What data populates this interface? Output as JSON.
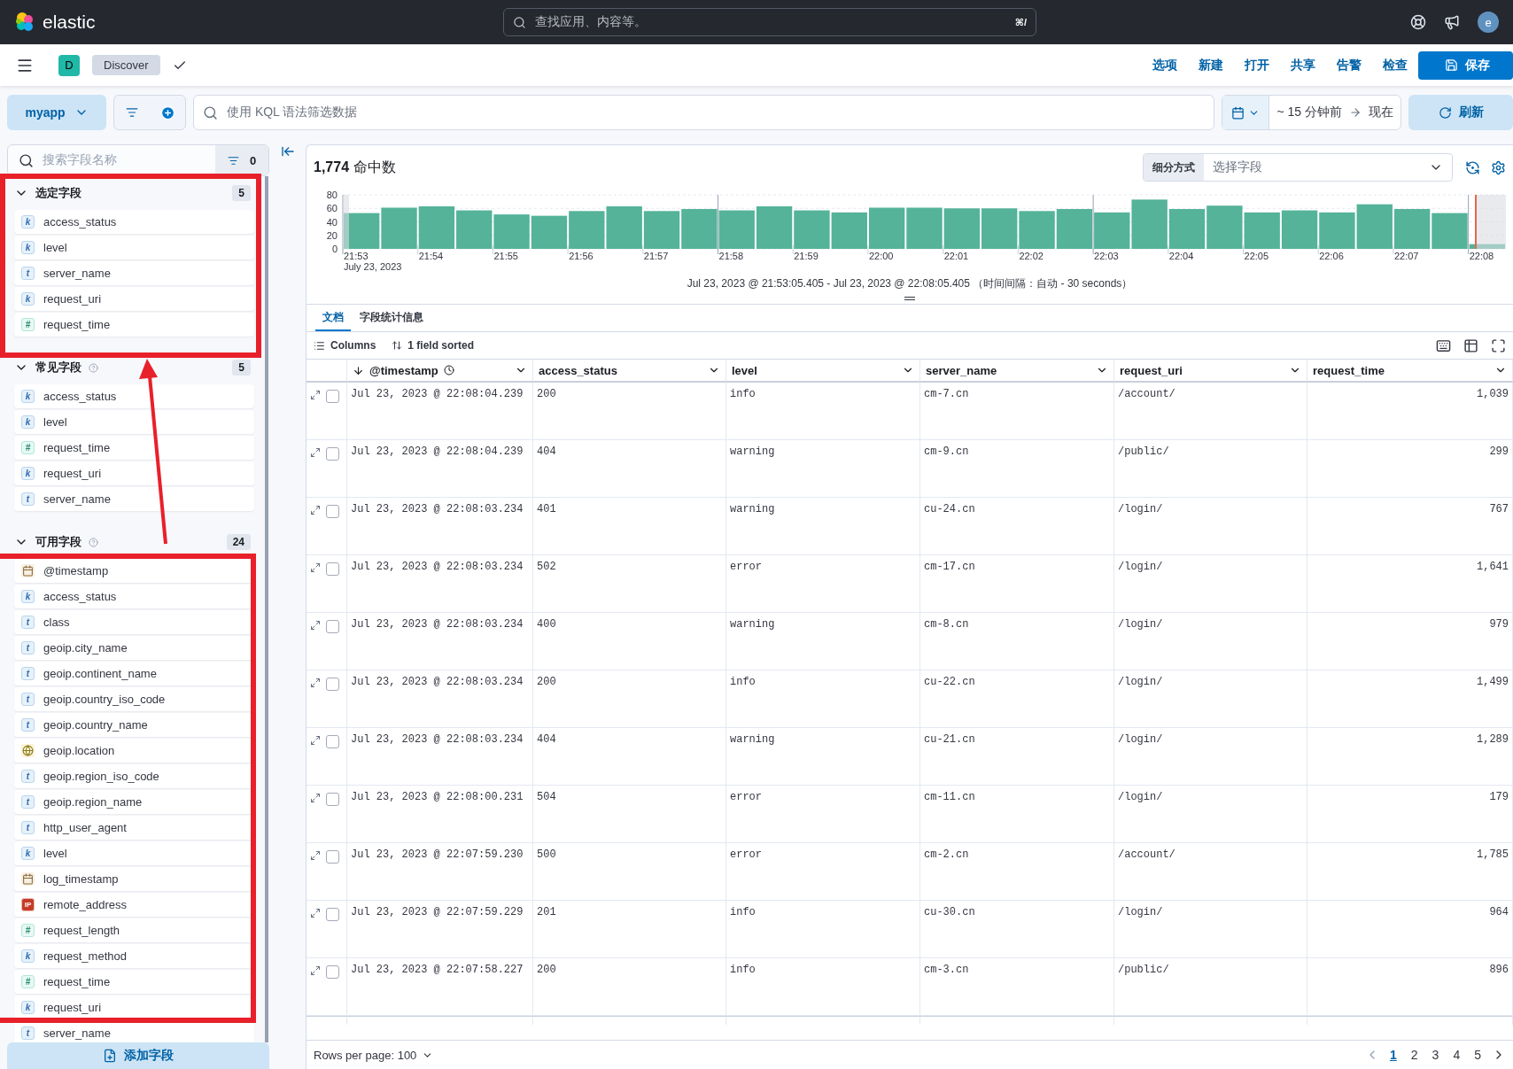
{
  "header": {
    "logo": "elastic",
    "search_placeholder": "查找应用、内容等。",
    "shortcut": "⌘/",
    "avatar": "e"
  },
  "app_bar": {
    "space": "D",
    "breadcrumb": "Discover",
    "menu": [
      "选项",
      "新建",
      "打开",
      "共享",
      "告警",
      "检查"
    ],
    "save": "保存"
  },
  "query_bar": {
    "data_view": "myapp",
    "placeholder": "使用 KQL 语法筛选数据",
    "time_start": "~ 15 分钟前",
    "time_end": "现在",
    "refresh": "刷新"
  },
  "sidebar": {
    "search_placeholder": "搜索字段名称",
    "filter_count": "0",
    "add_field": "添加字段",
    "sections": [
      {
        "title": "选定字段",
        "count": "5",
        "help": false,
        "expanded": true,
        "fields": [
          {
            "kind": "keyword",
            "token": "k",
            "name": "access_status"
          },
          {
            "kind": "keyword",
            "token": "k",
            "name": "level"
          },
          {
            "kind": "text",
            "token": "t",
            "name": "server_name"
          },
          {
            "kind": "keyword",
            "token": "k",
            "name": "request_uri"
          },
          {
            "kind": "number",
            "token": "#",
            "name": "request_time"
          }
        ]
      },
      {
        "title": "常见字段",
        "count": "5",
        "help": true,
        "expanded": true,
        "fields": [
          {
            "kind": "keyword",
            "token": "k",
            "name": "access_status"
          },
          {
            "kind": "keyword",
            "token": "k",
            "name": "level"
          },
          {
            "kind": "number",
            "token": "#",
            "name": "request_time"
          },
          {
            "kind": "keyword",
            "token": "k",
            "name": "request_uri"
          },
          {
            "kind": "text",
            "token": "t",
            "name": "server_name"
          }
        ]
      },
      {
        "title": "可用字段",
        "count": "24",
        "help": true,
        "expanded": true,
        "fields": [
          {
            "kind": "date",
            "name": "@timestamp"
          },
          {
            "kind": "keyword",
            "token": "k",
            "name": "access_status"
          },
          {
            "kind": "text",
            "token": "t",
            "name": "class"
          },
          {
            "kind": "text",
            "token": "t",
            "name": "geoip.city_name"
          },
          {
            "kind": "text",
            "token": "t",
            "name": "geoip.continent_name"
          },
          {
            "kind": "text",
            "token": "t",
            "name": "geoip.country_iso_code"
          },
          {
            "kind": "text",
            "token": "t",
            "name": "geoip.country_name"
          },
          {
            "kind": "geo",
            "name": "geoip.location"
          },
          {
            "kind": "text",
            "token": "t",
            "name": "geoip.region_iso_code"
          },
          {
            "kind": "text",
            "token": "t",
            "name": "geoip.region_name"
          },
          {
            "kind": "text",
            "token": "t",
            "name": "http_user_agent"
          },
          {
            "kind": "keyword",
            "token": "k",
            "name": "level"
          },
          {
            "kind": "date",
            "name": "log_timestamp"
          },
          {
            "kind": "ip",
            "token": "IP",
            "name": "remote_address"
          },
          {
            "kind": "number",
            "token": "#",
            "name": "request_length"
          },
          {
            "kind": "keyword",
            "token": "k",
            "name": "request_method"
          },
          {
            "kind": "number",
            "token": "#",
            "name": "request_time"
          },
          {
            "kind": "keyword",
            "token": "k",
            "name": "request_uri"
          },
          {
            "kind": "text",
            "token": "t",
            "name": "server_name"
          }
        ]
      }
    ]
  },
  "histogram": {
    "hits_count": "1,774",
    "hits_label": "命中数",
    "breakdown_label": "细分方式",
    "breakdown_placeholder": "选择字段",
    "date_label": "July 23, 2023",
    "range": "Jul 23, 2023 @ 21:53:05.405 - Jul 23, 2023 @ 22:08:05.405 （时间间隔：自动 - 30 seconds）",
    "chart_data": {
      "type": "bar",
      "categories": [
        "21:53",
        null,
        "21:54",
        null,
        "21:55",
        null,
        "21:56",
        null,
        "21:57",
        null,
        "21:58",
        null,
        "21:59",
        null,
        "22:00",
        null,
        "22:01",
        null,
        "22:02",
        null,
        "22:03",
        null,
        "22:04",
        null,
        "22:05",
        null,
        "22:06",
        null,
        "22:07",
        null,
        "22:08"
      ],
      "grid": true,
      "values": [
        53,
        61,
        63,
        57,
        51,
        49,
        56,
        63,
        56,
        59,
        57,
        63,
        57,
        54,
        61,
        61,
        60,
        60,
        56,
        59,
        54,
        73,
        59,
        64,
        54,
        57,
        54,
        66,
        59,
        53,
        7
      ],
      "ylim": [
        0,
        80
      ],
      "yticks": [
        0,
        20,
        40,
        60,
        80
      ]
    }
  },
  "tabs": [
    {
      "label": "文档",
      "selected": true
    },
    {
      "label": "字段统计信息",
      "selected": false
    }
  ],
  "grid_toolbar": {
    "columns": "Columns",
    "sorted": "1 field sorted"
  },
  "table": {
    "columns": [
      "@timestamp",
      "access_status",
      "level",
      "server_name",
      "request_uri",
      "request_time"
    ],
    "rows": [
      {
        "checked": false,
        "cells": [
          "Jul 23, 2023 @ 22:08:04.239",
          "200",
          "info",
          "cm-7.cn",
          "/account/",
          "1,039"
        ]
      },
      {
        "checked": false,
        "cells": [
          "Jul 23, 2023 @ 22:08:04.239",
          "404",
          "warning",
          "cm-9.cn",
          "/public/",
          "299"
        ]
      },
      {
        "checked": false,
        "cells": [
          "Jul 23, 2023 @ 22:08:03.234",
          "401",
          "warning",
          "cu-24.cn",
          "/login/",
          "767"
        ]
      },
      {
        "checked": false,
        "cells": [
          "Jul 23, 2023 @ 22:08:03.234",
          "502",
          "error",
          "cm-17.cn",
          "/login/",
          "1,641"
        ]
      },
      {
        "checked": false,
        "cells": [
          "Jul 23, 2023 @ 22:08:03.234",
          "400",
          "warning",
          "cm-8.cn",
          "/login/",
          "979"
        ]
      },
      {
        "checked": false,
        "cells": [
          "Jul 23, 2023 @ 22:08:03.234",
          "200",
          "info",
          "cu-22.cn",
          "/login/",
          "1,499"
        ]
      },
      {
        "checked": false,
        "cells": [
          "Jul 23, 2023 @ 22:08:03.234",
          "404",
          "warning",
          "cu-21.cn",
          "/login/",
          "1,289"
        ]
      },
      {
        "checked": false,
        "cells": [
          "Jul 23, 2023 @ 22:08:00.231",
          "504",
          "error",
          "cm-11.cn",
          "/login/",
          "179"
        ]
      },
      {
        "checked": false,
        "cells": [
          "Jul 23, 2023 @ 22:07:59.230",
          "500",
          "error",
          "cm-2.cn",
          "/account/",
          "1,785"
        ]
      },
      {
        "checked": false,
        "cells": [
          "Jul 23, 2023 @ 22:07:59.229",
          "201",
          "info",
          "cu-30.cn",
          "/login/",
          "964"
        ]
      },
      {
        "checked": false,
        "cells": [
          "Jul 23, 2023 @ 22:07:58.227",
          "200",
          "info",
          "cm-3.cn",
          "/public/",
          "896"
        ]
      }
    ]
  },
  "footer": {
    "rows_per_page": "Rows per page: 100",
    "pages": [
      {
        "label": "1",
        "selected": true
      },
      {
        "label": "2",
        "selected": false
      },
      {
        "label": "3",
        "selected": false
      },
      {
        "label": "4",
        "selected": false
      },
      {
        "label": "5",
        "selected": false
      }
    ]
  },
  "annotation_marks": [
    {
      "kind": "box"
    },
    {
      "kind": "box"
    },
    {
      "kind": "arrow"
    }
  ]
}
